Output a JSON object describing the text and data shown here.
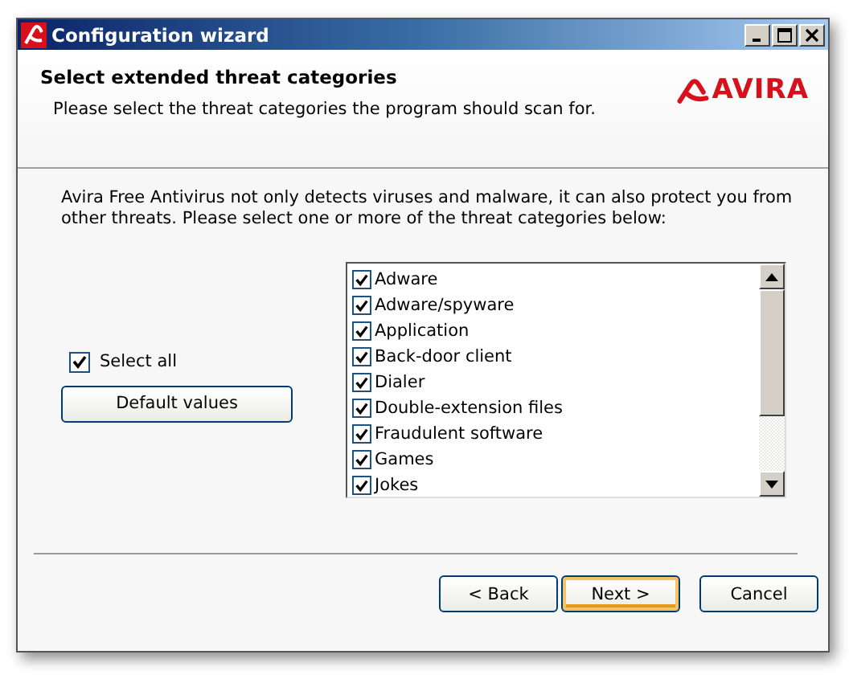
{
  "window": {
    "title": "Configuration wizard"
  },
  "header": {
    "title": "Select extended threat categories",
    "subtitle": "Please select the threat categories the program should scan for.",
    "logo": "AVIRA"
  },
  "intro": "Avira Free Antivirus not only detects viruses and malware,  it can also protect you from other threats. Please select one or more of the threat categories below:",
  "select_all": {
    "label": "Select all",
    "checked": true
  },
  "default_button": "Default values",
  "categories": [
    {
      "label": "Adware",
      "checked": true
    },
    {
      "label": "Adware/spyware",
      "checked": true
    },
    {
      "label": "Application",
      "checked": true
    },
    {
      "label": "Back-door client",
      "checked": true
    },
    {
      "label": "Dialer",
      "checked": true
    },
    {
      "label": "Double-extension files",
      "checked": true
    },
    {
      "label": "Fraudulent software",
      "checked": true
    },
    {
      "label": "Games",
      "checked": true
    },
    {
      "label": "Jokes",
      "checked": true
    }
  ],
  "buttons": [
    {
      "label": "< Back",
      "default": false
    },
    {
      "label": "Next >",
      "default": true
    },
    {
      "label": "Cancel",
      "default": false
    }
  ]
}
